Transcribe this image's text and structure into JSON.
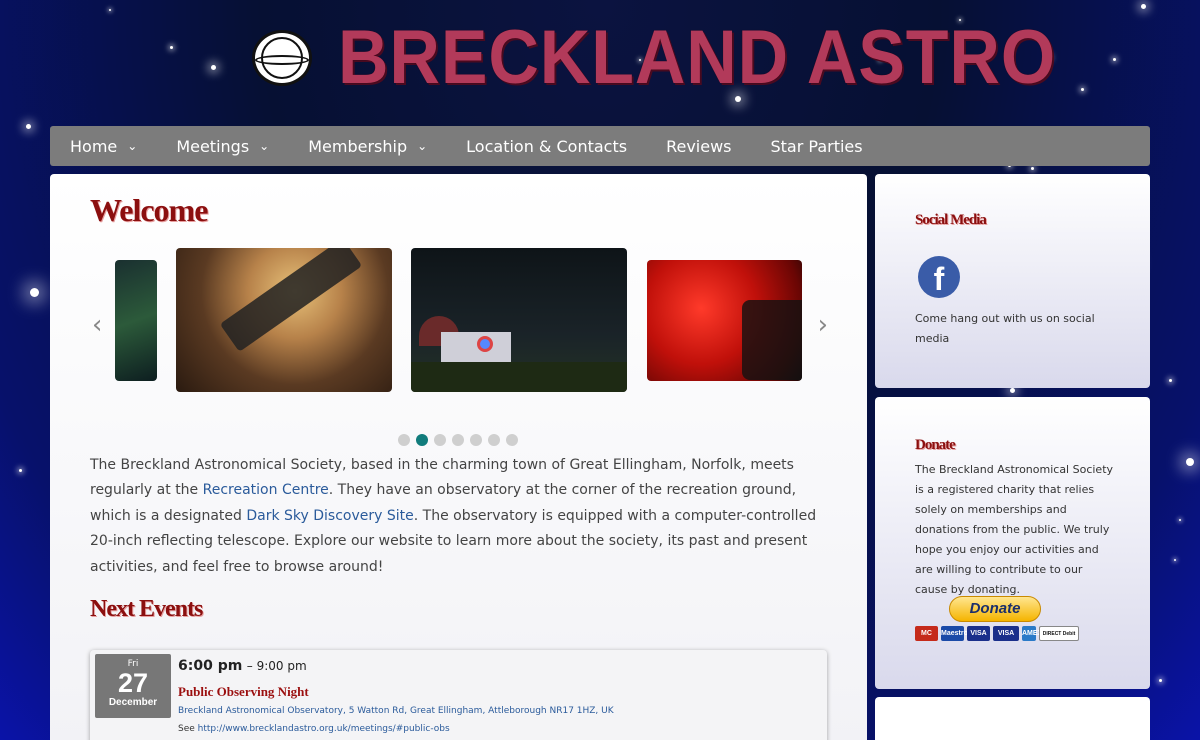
{
  "header": {
    "site_title": "BRECKLAND ASTRO",
    "logo": "breckland-astronomical-society-seal"
  },
  "nav": {
    "items": [
      {
        "label": "Home",
        "has_dropdown": true
      },
      {
        "label": "Meetings",
        "has_dropdown": true
      },
      {
        "label": "Membership",
        "has_dropdown": true
      },
      {
        "label": "Location & Contacts",
        "has_dropdown": false
      },
      {
        "label": "Reviews",
        "has_dropdown": false
      },
      {
        "label": "Star Parties",
        "has_dropdown": false
      }
    ],
    "chevron": "⌄"
  },
  "main": {
    "welcome_title": "Welcome",
    "carousel": {
      "prev_icon": "chevron-left-icon",
      "next_icon": "chevron-right-icon",
      "active_dot": 2,
      "dot_count": 7
    },
    "intro": {
      "p1": "The Breckland Astronomical Society, based in the charming town of Great Ellingham, Norfolk, meets regularly at the ",
      "link1": "Recreation Centre",
      "p2": ". They have an observatory at the corner of the recreation ground, which is a designated ",
      "link2": "Dark Sky Discovery Site",
      "p3": ". The observatory is equipped with a computer-controlled 20-inch reflecting telescope. Explore our website to learn more about the society, its past and present activities, and feel free to browse around!"
    },
    "next_events_title": "Next Events",
    "event": {
      "dow": "Fri",
      "day": "27",
      "month": "December",
      "start": "6:00 pm",
      "end": "– 9:00 pm",
      "title": "Public Observing Night",
      "location": "Breckland Astronomical Observatory, 5 Watton Rd, Great Ellingham, Attleborough NR17 1HZ, UK",
      "see_label": "See ",
      "see_link": "http://www.brecklandastro.org.uk/meetings/#public-obs"
    }
  },
  "sidebar": {
    "social": {
      "title": "Social Media",
      "fb_letter": "f",
      "text": "Come hang out with us on social media"
    },
    "donate": {
      "title": "Donate",
      "text": "The Breckland Astronomical Society is a registered charity that relies solely on memberships and donations from the public. We truly hope you enjoy our activities and are willing to contribute to our cause by donating.",
      "button": "Donate",
      "cards": [
        "MC",
        "Maestro",
        "VISA",
        "VISA",
        "AMEX",
        "DIRECT Debit"
      ]
    }
  },
  "colors": {
    "heading": "#8b0f0f",
    "nav_bg": "#7c7c7c",
    "link": "#2b5b9b",
    "dot_active": "#117c7c"
  }
}
